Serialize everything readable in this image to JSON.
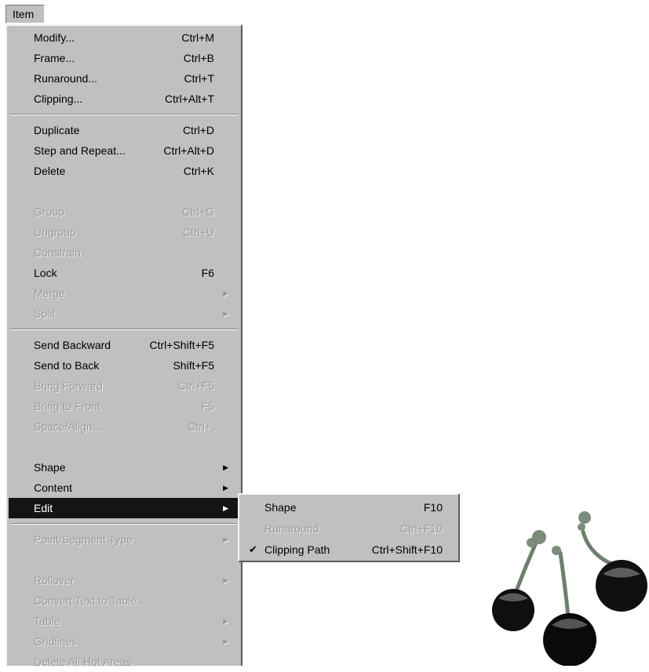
{
  "menubar": {
    "item_label": "Item"
  },
  "menu": {
    "groups": [
      [
        {
          "label": "Modify...",
          "shortcut": "Ctrl+M",
          "enabled": true
        },
        {
          "label": "Frame...",
          "shortcut": "Ctrl+B",
          "enabled": true
        },
        {
          "label": "Runaround...",
          "shortcut": "Ctrl+T",
          "enabled": true
        },
        {
          "label": "Clipping...",
          "shortcut": "Ctrl+Alt+T",
          "enabled": true
        }
      ],
      [
        {
          "label": "Duplicate",
          "shortcut": "Ctrl+D",
          "enabled": true
        },
        {
          "label": "Step and Repeat...",
          "shortcut": "Ctrl+Alt+D",
          "enabled": true
        },
        {
          "label": "Delete",
          "shortcut": "Ctrl+K",
          "enabled": true
        },
        {
          "label": "",
          "shortcut": "",
          "enabled": false,
          "spacer": true
        },
        {
          "label": "Group",
          "shortcut": "Ctrl+G",
          "enabled": false
        },
        {
          "label": "Ungroup",
          "shortcut": "Ctrl+U",
          "enabled": false
        },
        {
          "label": "Constrain",
          "shortcut": "",
          "enabled": false
        },
        {
          "label": "Lock",
          "shortcut": "F6",
          "enabled": true
        },
        {
          "label": "Merge",
          "shortcut": "",
          "enabled": false,
          "submenu": true
        },
        {
          "label": "Split",
          "shortcut": "",
          "enabled": false,
          "submenu": true
        }
      ],
      [
        {
          "label": "Send Backward",
          "shortcut": "Ctrl+Shift+F5",
          "enabled": true
        },
        {
          "label": "Send to Back",
          "shortcut": "Shift+F5",
          "enabled": true
        },
        {
          "label": "Bring Forward",
          "shortcut": "Ctrl+F5",
          "enabled": false
        },
        {
          "label": "Bring to Front",
          "shortcut": "F5",
          "enabled": false
        },
        {
          "label": "Space/Align...",
          "shortcut": "Ctrl+,",
          "enabled": false
        },
        {
          "label": "",
          "shortcut": "",
          "enabled": false,
          "spacer": true
        },
        {
          "label": "Shape",
          "shortcut": "",
          "enabled": true,
          "submenu": true
        },
        {
          "label": "Content",
          "shortcut": "",
          "enabled": true,
          "submenu": true
        },
        {
          "label": "Edit",
          "shortcut": "",
          "enabled": true,
          "submenu": true,
          "selected": true
        }
      ],
      [
        {
          "label": "Point/Segment Type",
          "shortcut": "",
          "enabled": false,
          "submenu": true
        },
        {
          "label": "",
          "shortcut": "",
          "enabled": false,
          "spacer": true
        },
        {
          "label": "Rollover",
          "shortcut": "",
          "enabled": false,
          "submenu": true
        },
        {
          "label": "Convert Text to Table...",
          "shortcut": "",
          "enabled": false
        },
        {
          "label": "Table",
          "shortcut": "",
          "enabled": false,
          "submenu": true
        },
        {
          "label": "Gridlines",
          "shortcut": "",
          "enabled": false,
          "submenu": true
        },
        {
          "label": "Delete All Hot Areas",
          "shortcut": "",
          "enabled": false
        }
      ]
    ]
  },
  "submenu": {
    "items": [
      {
        "label": "Shape",
        "shortcut": "F10",
        "enabled": true,
        "checked": false
      },
      {
        "label": "Runaround",
        "shortcut": "Ctrl+F10",
        "enabled": false,
        "checked": false
      },
      {
        "label": "Clipping Path",
        "shortcut": "Ctrl+Shift+F10",
        "enabled": true,
        "checked": true
      }
    ]
  },
  "icons": {
    "submenu_arrow": "triangle-right-icon",
    "check": "checkmark-icon"
  }
}
